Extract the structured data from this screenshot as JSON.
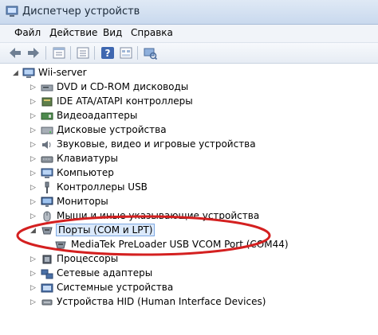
{
  "window": {
    "title": "Диспетчер устройств"
  },
  "menu": {
    "items": [
      "Файл",
      "Действие",
      "Вид",
      "Справка"
    ]
  },
  "toolbar": {
    "buttons": [
      "back-arrow-icon",
      "forward-arrow-icon",
      "properties-icon",
      "list-icon",
      "help-icon",
      "console-icon",
      "scan-hardware-icon"
    ]
  },
  "tree": {
    "root": "Wii-server",
    "items": [
      {
        "label": "DVD и CD-ROM дисководы",
        "icon": "dvd-drive-icon",
        "expanded": false
      },
      {
        "label": "IDE ATA/ATAPI контроллеры",
        "icon": "ide-controller-icon",
        "expanded": false
      },
      {
        "label": "Видеоадаптеры",
        "icon": "display-adapter-icon",
        "expanded": false
      },
      {
        "label": "Дисковые устройства",
        "icon": "disk-drive-icon",
        "expanded": false
      },
      {
        "label": "Звуковые, видео и игровые устройства",
        "icon": "sound-icon",
        "expanded": false
      },
      {
        "label": "Клавиатуры",
        "icon": "keyboard-icon",
        "expanded": false
      },
      {
        "label": "Компьютер",
        "icon": "computer-icon",
        "expanded": false
      },
      {
        "label": "Контроллеры USB",
        "icon": "usb-icon",
        "expanded": false
      },
      {
        "label": "Мониторы",
        "icon": "monitor-icon",
        "expanded": false
      },
      {
        "label": "Мыши и иные указывающие устройства",
        "icon": "mouse-icon",
        "expanded": false
      },
      {
        "label": "Порты (COM и LPT)",
        "icon": "port-icon",
        "expanded": true,
        "selected": true
      },
      {
        "label": "MediaTek PreLoader USB VCOM Port (COM44)",
        "icon": "port-device-icon",
        "child": true
      },
      {
        "label": "Процессоры",
        "icon": "processor-icon",
        "expanded": false
      },
      {
        "label": "Сетевые адаптеры",
        "icon": "network-adapter-icon",
        "expanded": false
      },
      {
        "label": "Системные устройства",
        "icon": "system-device-icon",
        "expanded": false
      },
      {
        "label": "Устройства HID (Human Interface Devices)",
        "icon": "hid-icon",
        "expanded": false
      }
    ]
  },
  "colors": {
    "highlight_ellipse": "#d42020",
    "selection": "#dbe9fb"
  }
}
